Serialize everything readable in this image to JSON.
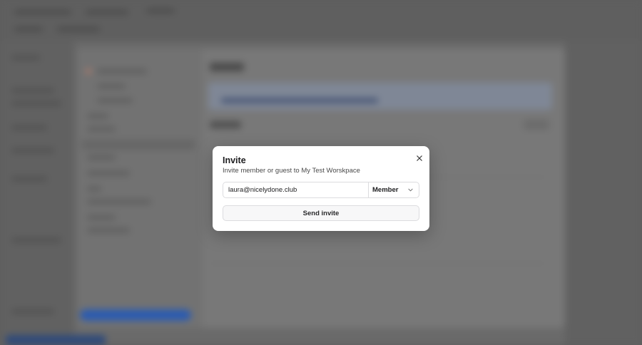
{
  "modal": {
    "title": "Invite",
    "subtitle": "Invite member or guest to My Test Worskpace",
    "email_value": "laura@nicelydone.club",
    "role_selected": "Member",
    "send_label": "Send invite",
    "close_icon": "close-icon",
    "chevron_icon": "chevron-down-icon"
  }
}
